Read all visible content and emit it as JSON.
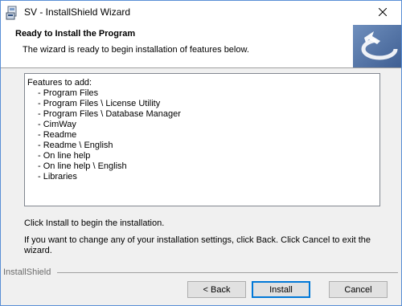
{
  "window": {
    "title": "SV - InstallShield Wizard"
  },
  "header": {
    "title": "Ready to Install the Program",
    "subtitle": "The wizard is ready to begin installation of features below."
  },
  "features": {
    "label": "Features to add:",
    "items": [
      "- Program Files",
      "- Program Files \\ License Utility",
      "- Program Files \\ Database Manager",
      "- CimWay",
      "- Readme",
      "- Readme \\ English",
      "- On line help",
      "- On line help \\ English",
      "- Libraries"
    ]
  },
  "messages": {
    "install_hint": "Click Install to begin the installation.",
    "change_hint": "If you want to change any of your installation settings, click Back. Click Cancel to exit the wizard."
  },
  "footer": {
    "brand": "InstallShield",
    "back_label": "< Back",
    "install_label": "Install",
    "cancel_label": "Cancel"
  },
  "colors": {
    "window_border": "#5a8fd6",
    "logo_bg": "#4a6fa5",
    "default_button_border": "#0078d7"
  }
}
